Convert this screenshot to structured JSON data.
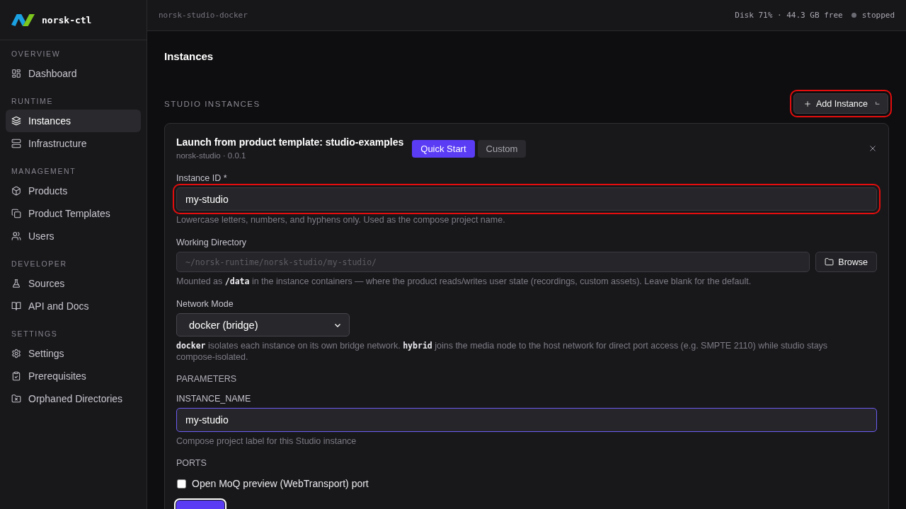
{
  "sidebar": {
    "brand": "norsk-ctl",
    "sections": [
      {
        "title": "OVERVIEW",
        "items": [
          {
            "label": "Dashboard",
            "selected": false
          }
        ]
      },
      {
        "title": "RUNTIME",
        "items": [
          {
            "label": "Instances",
            "selected": true
          },
          {
            "label": "Infrastructure",
            "selected": false
          }
        ]
      },
      {
        "title": "MANAGEMENT",
        "items": [
          {
            "label": "Products",
            "selected": false
          },
          {
            "label": "Product Templates",
            "selected": false
          },
          {
            "label": "Users",
            "selected": false
          }
        ]
      },
      {
        "title": "DEVELOPER",
        "items": [
          {
            "label": "Sources",
            "selected": false
          },
          {
            "label": "API and Docs",
            "selected": false
          }
        ]
      },
      {
        "title": "SETTINGS",
        "items": [
          {
            "label": "Settings",
            "selected": false
          },
          {
            "label": "Prerequisites",
            "selected": false
          },
          {
            "label": "Orphaned Directories",
            "selected": false
          }
        ]
      }
    ]
  },
  "top_bar": {
    "context": "norsk-studio-docker",
    "disk": "Disk 71% · 44.3 GB free",
    "status": {
      "label": "stopped",
      "running": false
    }
  },
  "page": {
    "title": "Instances",
    "section_title": "STUDIO INSTANCES",
    "add_button": {
      "label": "Add Instance",
      "highlighted": true
    }
  },
  "launch_panel": {
    "title": "Launch from product template: studio-examples",
    "subtitle": "norsk-studio · 0.0.1",
    "modes": [
      {
        "label": "Quick Start",
        "selected": true
      },
      {
        "label": "Custom",
        "selected": false
      }
    ],
    "fields": [
      {
        "kind": "text",
        "label": "Instance ID *",
        "value": "my-studio",
        "highlighted": true,
        "hint": "Lowercase letters, numbers, and hyphens only. Used as the compose project name."
      },
      {
        "kind": "path",
        "label": "Working Directory",
        "placeholder": "~/norsk-runtime/norsk-studio/my-studio/",
        "button": "Browse",
        "hint": "Mounted as **/data** in the instance containers — where the product reads/writes user state (recordings, custom assets). Leave blank for the default."
      },
      {
        "kind": "select",
        "label": "Network Mode",
        "value": "docker (bridge)",
        "hint": "**docker** isolates each instance on its own bridge network. **hybrid** joins the media node to the host network for direct port access (e.g. SMPTE 2110) while studio stays compose-isolated."
      }
    ],
    "parameters": {
      "title": "PARAMETERS",
      "fields": [
        {
          "label": "INSTANCE_NAME",
          "value": "my-studio",
          "focused": true,
          "hint": "Compose project label for this Studio instance"
        }
      ]
    },
    "ports": {
      "title": "PORTS",
      "options": [
        {
          "label": "Open MoQ preview (WebTransport) port",
          "checked": false
        }
      ]
    },
    "actions": [
      {
        "kind": "primary",
        "focused": true
      }
    ]
  }
}
